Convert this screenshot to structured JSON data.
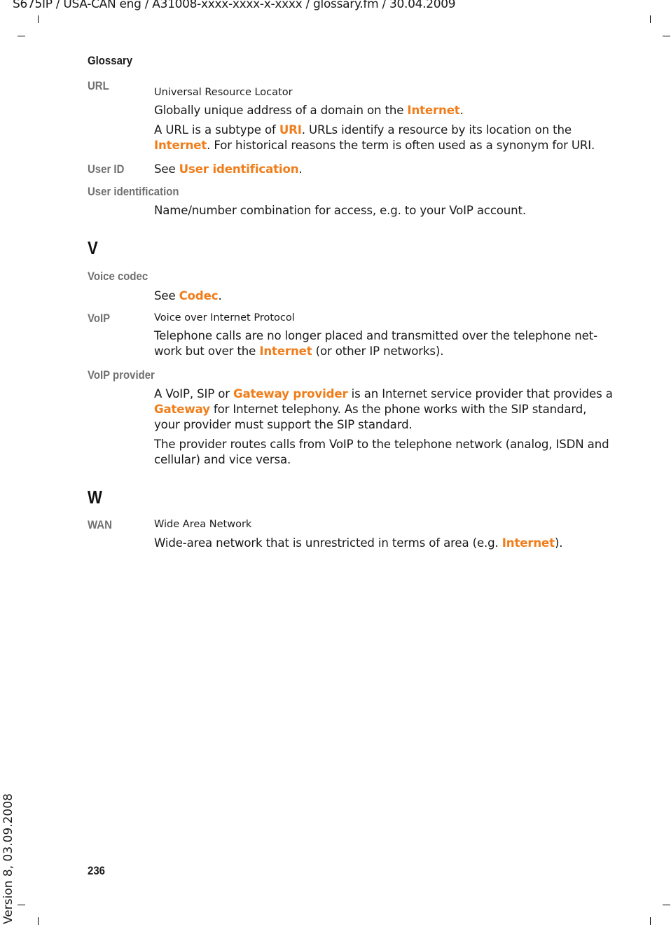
{
  "header": {
    "text": "S675IP  / USA-CAN eng / A31008-xxxx-xxxx-x-xxxx / glossary.fm / 30.04.2009"
  },
  "section_title": "Glossary",
  "colors": {
    "link": "#f07d1a",
    "term": "#707070"
  },
  "entries": [
    {
      "kind": "term",
      "term": "URL",
      "subtitle": "Universal Resource Locator",
      "lines": [
        [
          {
            "t": "Globally unique address of a domain on the "
          },
          {
            "t": "Internet",
            "link": true
          },
          {
            "t": "."
          }
        ],
        [
          {
            "t": "A URL is a subtype of "
          },
          {
            "t": "URI",
            "link": true
          },
          {
            "t": ". URLs identify a resource by its location on the"
          }
        ],
        [
          {
            "t": "Internet",
            "link": true
          },
          {
            "t": ". For historical reasons the term is often used as a synonym for URI."
          }
        ]
      ]
    },
    {
      "kind": "term",
      "term": "User ID",
      "lines": [
        [
          {
            "t": "See "
          },
          {
            "t": "User identification",
            "link": true
          },
          {
            "t": "."
          }
        ]
      ]
    },
    {
      "kind": "term",
      "term": "User identification",
      "lines": [
        [
          {
            "t": "Name/number combination for access, e.g. to your VoIP account."
          }
        ]
      ]
    },
    {
      "kind": "letter",
      "term": "V"
    },
    {
      "kind": "term",
      "term": "Voice codec",
      "lines": [
        [
          {
            "t": "See "
          },
          {
            "t": "Codec",
            "link": true
          },
          {
            "t": "."
          }
        ]
      ]
    },
    {
      "kind": "term",
      "term": "VoIP",
      "subtitle": "Voice over Internet Protocol",
      "lines": [
        [
          {
            "t": "Telephone calls are no longer placed and transmitted over the telephone net-"
          }
        ],
        [
          {
            "t": "work but over the "
          },
          {
            "t": "Internet",
            "link": true
          },
          {
            "t": " (or other IP networks)."
          }
        ]
      ]
    },
    {
      "kind": "term",
      "term": "VoIP provider",
      "lines": [
        [
          {
            "t": "A VoIP, SIP or "
          },
          {
            "t": "Gateway provider",
            "link": true
          },
          {
            "t": " is an Internet service provider that provides a"
          }
        ],
        [
          {
            "t": "Gateway",
            "link": true
          },
          {
            "t": " for Internet telephony. As the phone works with the SIP standard,"
          }
        ],
        [
          {
            "t": "your provider must support the SIP standard."
          }
        ],
        [
          {
            "t": "The provider routes calls from VoIP to the telephone network (analog, ISDN and"
          }
        ],
        [
          {
            "t": "cellular) and vice versa."
          }
        ]
      ]
    },
    {
      "kind": "letter",
      "term": "W"
    },
    {
      "kind": "term",
      "term": "WAN",
      "subtitle": "Wide Area Network",
      "lines": [
        [
          {
            "t": "Wide-area network that is unrestricted in terms of area (e.g. "
          },
          {
            "t": "Internet",
            "link": true
          },
          {
            "t": ")."
          }
        ]
      ]
    }
  ],
  "page_number": "236",
  "version": "Version 8, 03.09.2008"
}
